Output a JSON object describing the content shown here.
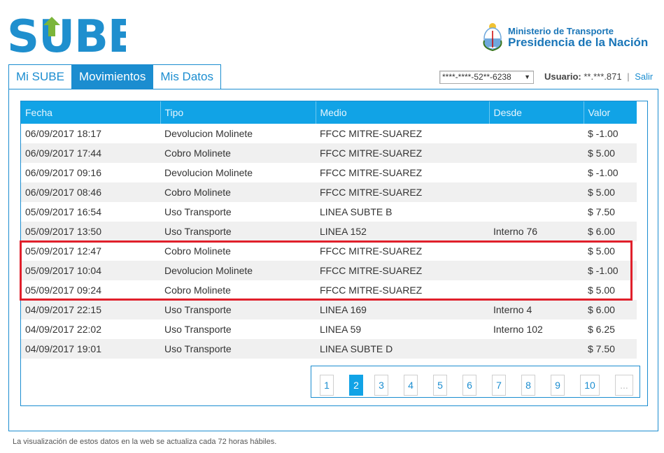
{
  "brand": {
    "logo_text": "SUBE",
    "logo_color": "#1f8fce",
    "arrow_color": "#7bb53a"
  },
  "ministry": {
    "line1": "Ministerio de Transporte",
    "line2": "Presidencia de la Nación"
  },
  "tabs": [
    {
      "label": "Mi SUBE",
      "active": false
    },
    {
      "label": "Movimientos",
      "active": true
    },
    {
      "label": "Mis Datos",
      "active": false
    }
  ],
  "card_select": {
    "selected": "****-****-52**-6238"
  },
  "user": {
    "label": "Usuario:",
    "value": "**.***.871",
    "separator": "|",
    "logout": "Salir"
  },
  "table": {
    "headers": [
      "Fecha",
      "Tipo",
      "Medio",
      "Desde",
      "Valor"
    ],
    "rows": [
      [
        "06/09/2017 18:17",
        "Devolucion Molinete",
        "FFCC MITRE-SUAREZ",
        "",
        "$ -1.00"
      ],
      [
        "06/09/2017 17:44",
        "Cobro Molinete",
        "FFCC MITRE-SUAREZ",
        "",
        "$ 5.00"
      ],
      [
        "06/09/2017 09:16",
        "Devolucion Molinete",
        "FFCC MITRE-SUAREZ",
        "",
        "$ -1.00"
      ],
      [
        "06/09/2017 08:46",
        "Cobro Molinete",
        "FFCC MITRE-SUAREZ",
        "",
        "$ 5.00"
      ],
      [
        "05/09/2017 16:54",
        "Uso Transporte",
        "LINEA SUBTE B",
        "",
        "$ 7.50"
      ],
      [
        "05/09/2017 13:50",
        "Uso Transporte",
        "LINEA 152",
        "Interno 76",
        "$ 6.00"
      ],
      [
        "05/09/2017 12:47",
        "Cobro Molinete",
        "FFCC MITRE-SUAREZ",
        "",
        "$ 5.00"
      ],
      [
        "05/09/2017 10:04",
        "Devolucion Molinete",
        "FFCC MITRE-SUAREZ",
        "",
        "$ -1.00"
      ],
      [
        "05/09/2017 09:24",
        "Cobro Molinete",
        "FFCC MITRE-SUAREZ",
        "",
        "$ 5.00"
      ],
      [
        "04/09/2017 22:15",
        "Uso Transporte",
        "LINEA 169",
        "Interno 4",
        "$ 6.00"
      ],
      [
        "04/09/2017 22:02",
        "Uso Transporte",
        "LINEA 59",
        "Interno 102",
        "$ 6.25"
      ],
      [
        "04/09/2017 19:01",
        "Uso Transporte",
        "LINEA SUBTE D",
        "",
        "$ 7.50"
      ]
    ],
    "highlight_color": "#e0202b"
  },
  "pagination": {
    "pages": [
      "1",
      "2",
      "3",
      "4",
      "5",
      "6",
      "7",
      "8",
      "9",
      "10",
      "..."
    ],
    "current": "2"
  },
  "footnote": "La visualización de estos datos en la web se actualiza cada 72 horas hábiles."
}
